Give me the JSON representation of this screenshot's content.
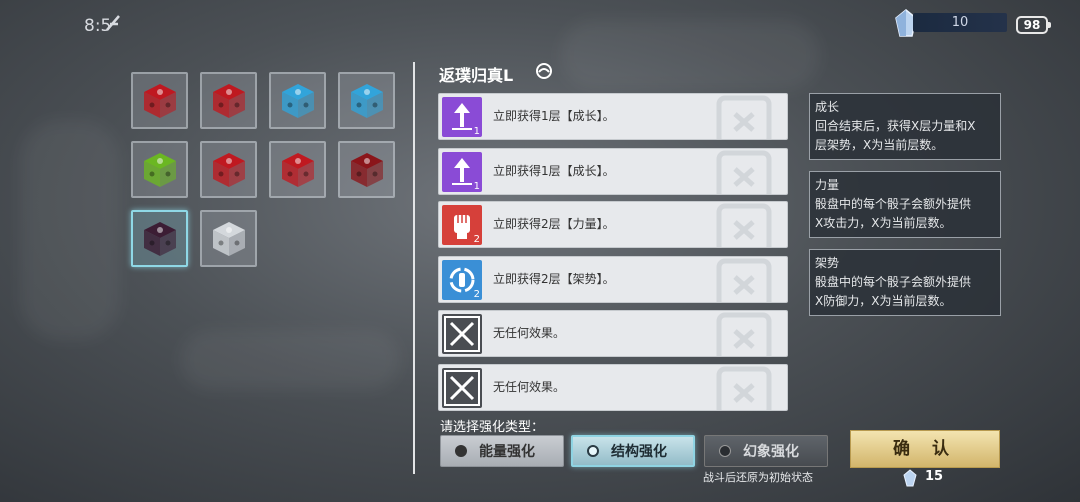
{
  "status": {
    "time": "8:5",
    "crystal_count": "10",
    "battery": "98"
  },
  "dice": [
    {
      "name": "dice-red-1",
      "color": "#c4141b"
    },
    {
      "name": "dice-red-2",
      "color": "#c4141b"
    },
    {
      "name": "dice-blue-1",
      "color": "#2ea6df"
    },
    {
      "name": "dice-blue-2",
      "color": "#2ea6df"
    },
    {
      "name": "dice-green",
      "color": "#6cbb1d"
    },
    {
      "name": "dice-red-blue-1",
      "color": "#c4141b"
    },
    {
      "name": "dice-red-blue-2",
      "color": "#c4141b"
    },
    {
      "name": "dice-dark-red",
      "color": "#8c1014"
    },
    {
      "name": "dice-dark-purple",
      "color": "#3a1830"
    },
    {
      "name": "dice-white",
      "color": "#d9dde2"
    }
  ],
  "card_title": "返璞归真L",
  "effects": [
    {
      "icon": "growth-icon",
      "color": "#8a4bd6",
      "level": "1",
      "text": "立即获得1层【成长】。"
    },
    {
      "icon": "growth-icon",
      "color": "#8a4bd6",
      "level": "1",
      "text": "立即获得1层【成长】。"
    },
    {
      "icon": "strength-fist-icon",
      "color": "#d6403a",
      "level": "2",
      "text": "立即获得2层【力量】。"
    },
    {
      "icon": "stance-shield-icon",
      "color": "#3a8fd6",
      "level": "2",
      "text": "立即获得2层【架势】。"
    },
    {
      "icon": "empty-x-icon",
      "color": "#4a4d52",
      "level": "",
      "text": "无任何效果。"
    },
    {
      "icon": "empty-x-icon",
      "color": "#4a4d52",
      "level": "",
      "text": "无任何效果。"
    }
  ],
  "tooltips": [
    {
      "title": "成长",
      "line1": "回合结束后，获得X层力量和X",
      "line2": "层架势，X为当前层数。"
    },
    {
      "title": "力量",
      "line1": "骰盘中的每个骰子会额外提供",
      "line2": "X攻击力，X为当前层数。"
    },
    {
      "title": "架势",
      "line1": "骰盘中的每个骰子会额外提供",
      "line2": "X防御力，X为当前层数。"
    }
  ],
  "prompt": "请选择强化类型：",
  "options": [
    {
      "label": "能量强化",
      "state": "off"
    },
    {
      "label": "结构强化",
      "state": "selected"
    },
    {
      "label": "幻象强化",
      "state": "disabled"
    }
  ],
  "options_note": "战斗后还原为初始状态",
  "confirm_label": "确 认",
  "cost": "15"
}
